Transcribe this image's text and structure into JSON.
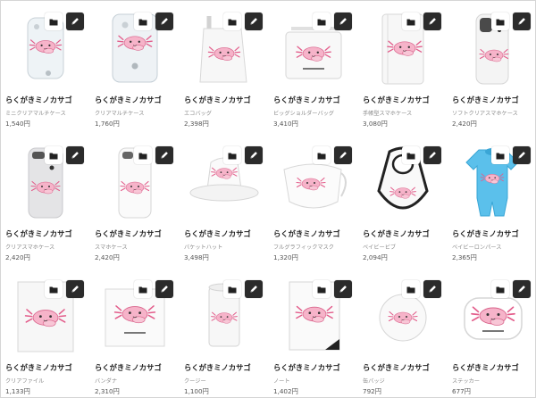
{
  "products": [
    {
      "name": "らくがきミノカサゴ",
      "type": "ミニクリアマルチケース",
      "price": "1,540円",
      "kind": "clear-case-small"
    },
    {
      "name": "らくがきミノカサゴ",
      "type": "クリアマルチケース",
      "price": "1,760円",
      "kind": "clear-case"
    },
    {
      "name": "らくがきミノカサゴ",
      "type": "エコバッグ",
      "price": "2,398円",
      "kind": "eco-bag"
    },
    {
      "name": "らくがきミノカサゴ",
      "type": "ビッグショルダーバッグ",
      "price": "3,410円",
      "kind": "shoulder-bag"
    },
    {
      "name": "らくがきミノカサゴ",
      "type": "手帳型スマホケース",
      "price": "3,080円",
      "kind": "notebook-case"
    },
    {
      "name": "らくがきミノカサゴ",
      "type": "ソフトクリアスマホケース",
      "price": "2,420円",
      "kind": "soft-phone-case"
    },
    {
      "name": "らくがきミノカサゴ",
      "type": "クリアスマホケース",
      "price": "2,420円",
      "kind": "clear-phone-case"
    },
    {
      "name": "らくがきミノカサゴ",
      "type": "スマホケース",
      "price": "2,420円",
      "kind": "phone-case"
    },
    {
      "name": "らくがきミノカサゴ",
      "type": "バケットハット",
      "price": "3,498円",
      "kind": "bucket-hat"
    },
    {
      "name": "らくがきミノカサゴ",
      "type": "フルグラフィックマスク",
      "price": "1,320円",
      "kind": "mask"
    },
    {
      "name": "らくがきミノカサゴ",
      "type": "ベイビービブ",
      "price": "2,094円",
      "kind": "bib"
    },
    {
      "name": "らくがきミノカサゴ",
      "type": "ベイビーロンパース",
      "price": "2,365円",
      "kind": "romper"
    },
    {
      "name": "らくがきミノカサゴ",
      "type": "クリアファイル",
      "price": "1,133円",
      "kind": "clear-file"
    },
    {
      "name": "らくがきミノカサゴ",
      "type": "バンダナ",
      "price": "2,310円",
      "kind": "bandana"
    },
    {
      "name": "らくがきミノカサゴ",
      "type": "クージー",
      "price": "1,100円",
      "kind": "koozie"
    },
    {
      "name": "らくがきミノカサゴ",
      "type": "ノート",
      "price": "1,402円",
      "kind": "notebook"
    },
    {
      "name": "らくがきミノカサゴ",
      "type": "缶バッジ",
      "price": "792円",
      "kind": "badge"
    },
    {
      "name": "らくがきミノカサゴ",
      "type": "ステッカー",
      "price": "677円",
      "kind": "sticker"
    }
  ],
  "icons": {
    "folder": "folder-icon",
    "edit": "pencil-icon"
  },
  "colors": {
    "accent_pink": "#f08fb0",
    "romper_blue": "#5bc0eb",
    "edit_button": "#2b2b2b"
  }
}
